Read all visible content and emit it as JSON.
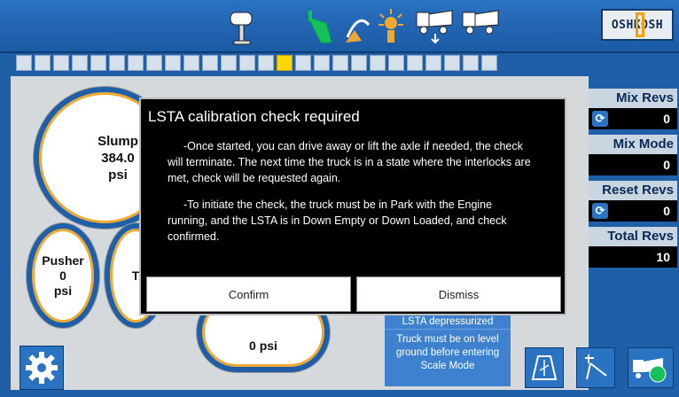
{
  "header": {
    "logo_text": "OSHKOSH",
    "icons": [
      "tower-icon",
      "shovel-icon",
      "water-spray-icon",
      "light-icon",
      "truck-down-icon",
      "truck-icon"
    ]
  },
  "progress_strip": {
    "cells": 26,
    "active_index": 14
  },
  "gauges": {
    "slump": {
      "label": "Slump",
      "value": "384.0",
      "unit": "psi"
    },
    "pusher": {
      "label": "Pusher",
      "value": "0",
      "unit": "psi"
    },
    "pusher2_partial": "T",
    "bottom": {
      "value": "0 psi"
    }
  },
  "right_panel": {
    "mix_revs": {
      "label": "Mix Revs",
      "value": "0"
    },
    "mix_mode": {
      "label": "Mix Mode",
      "value": "0"
    },
    "reset_revs": {
      "label": "Reset Revs",
      "value": "0"
    },
    "total_revs": {
      "label": "Total Revs",
      "value": "10"
    }
  },
  "info_box": {
    "status": "LSTA depressurized",
    "message": "Truck must be on level ground before entering Scale Mode"
  },
  "modal": {
    "title": "LSTA calibration check required",
    "para1": "-Once started, you can drive away or lift the axle if needed, the check will terminate. The next time the truck is in a state where the interlocks are met, check will be requested again.",
    "para2": "-To initiate the check, the truck must be in Park with the Engine running, and the LSTA is in Down Empty or Down Loaded, and check confirmed.",
    "confirm_label": "Confirm",
    "dismiss_label": "Dismiss"
  },
  "colors": {
    "accent": "#2a72c2",
    "active_step": "#ffd60a",
    "gauge_ring": "#f0a930"
  }
}
